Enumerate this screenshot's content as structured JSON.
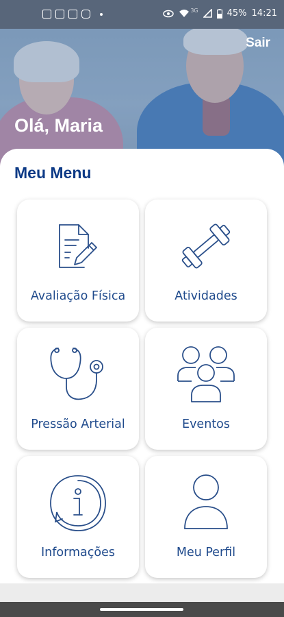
{
  "status_bar": {
    "battery": "45%",
    "time": "14:21",
    "network": "3G",
    "notification_icons": [
      "calendar-icon",
      "qr-icon",
      "facebook-icon",
      "instagram-icon"
    ],
    "system_icons": [
      "eye-icon",
      "wifi-icon",
      "signal-icon",
      "battery-icon"
    ]
  },
  "header": {
    "logout_label": "Sair",
    "greeting": "Olá, Maria"
  },
  "menu": {
    "title": "Meu Menu",
    "items": [
      {
        "label": "Avaliação Física",
        "icon": "document-edit-icon"
      },
      {
        "label": "Atividades",
        "icon": "dumbbell-icon"
      },
      {
        "label": "Pressão Arterial",
        "icon": "stethoscope-icon"
      },
      {
        "label": "Eventos",
        "icon": "people-group-icon"
      },
      {
        "label": "Informações",
        "icon": "info-icon"
      },
      {
        "label": "Meu Perfil",
        "icon": "user-profile-icon"
      }
    ]
  },
  "colors": {
    "accent": "#0d3a86",
    "tile_label": "#1f4a8c",
    "icon_stroke": "#2a4f8a"
  }
}
